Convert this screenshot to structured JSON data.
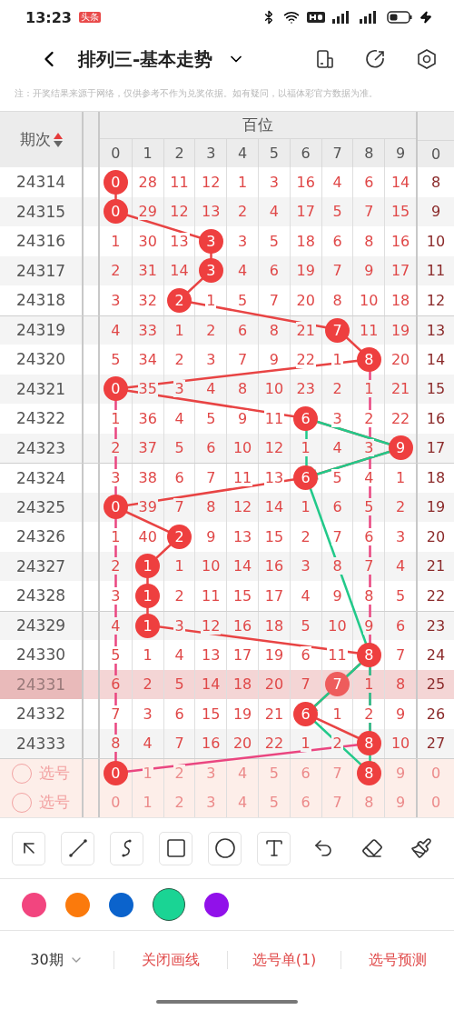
{
  "status_bar": {
    "time": "13:23",
    "badge": "头条"
  },
  "header": {
    "title": "排列三-基本走势"
  },
  "note": "注：开奖结果来源于网络，仅供参考不作为兑奖依据。如有疑问，以福体彩官方数据为准。",
  "table": {
    "period_header": "期次",
    "group_header": "百位",
    "digits": [
      "0",
      "1",
      "2",
      "3",
      "4",
      "5",
      "6",
      "7",
      "8",
      "9"
    ],
    "extra_digit": "0",
    "rows": [
      {
        "kind": "draw",
        "period": "24314",
        "highlighted": false,
        "extra": "8",
        "cells": [
          {
            "v": "0",
            "hit": true
          },
          {
            "v": "28",
            "hit": false
          },
          {
            "v": "11",
            "hit": false
          },
          {
            "v": "12",
            "hit": false
          },
          {
            "v": "1",
            "hit": false
          },
          {
            "v": "3",
            "hit": false
          },
          {
            "v": "16",
            "hit": false
          },
          {
            "v": "4",
            "hit": false
          },
          {
            "v": "6",
            "hit": false
          },
          {
            "v": "14",
            "hit": false
          }
        ]
      },
      {
        "kind": "draw",
        "period": "24315",
        "highlighted": false,
        "extra": "9",
        "cells": [
          {
            "v": "0",
            "hit": true
          },
          {
            "v": "29",
            "hit": false
          },
          {
            "v": "12",
            "hit": false
          },
          {
            "v": "13",
            "hit": false
          },
          {
            "v": "2",
            "hit": false
          },
          {
            "v": "4",
            "hit": false
          },
          {
            "v": "17",
            "hit": false
          },
          {
            "v": "5",
            "hit": false
          },
          {
            "v": "7",
            "hit": false
          },
          {
            "v": "15",
            "hit": false
          }
        ]
      },
      {
        "kind": "draw",
        "period": "24316",
        "highlighted": false,
        "extra": "10",
        "cells": [
          {
            "v": "1",
            "hit": false
          },
          {
            "v": "30",
            "hit": false
          },
          {
            "v": "13",
            "hit": false
          },
          {
            "v": "3",
            "hit": true
          },
          {
            "v": "3",
            "hit": false
          },
          {
            "v": "5",
            "hit": false
          },
          {
            "v": "18",
            "hit": false
          },
          {
            "v": "6",
            "hit": false
          },
          {
            "v": "8",
            "hit": false
          },
          {
            "v": "16",
            "hit": false
          }
        ]
      },
      {
        "kind": "draw",
        "period": "24317",
        "highlighted": false,
        "extra": "11",
        "cells": [
          {
            "v": "2",
            "hit": false
          },
          {
            "v": "31",
            "hit": false
          },
          {
            "v": "14",
            "hit": false
          },
          {
            "v": "3",
            "hit": true
          },
          {
            "v": "4",
            "hit": false
          },
          {
            "v": "6",
            "hit": false
          },
          {
            "v": "19",
            "hit": false
          },
          {
            "v": "7",
            "hit": false
          },
          {
            "v": "9",
            "hit": false
          },
          {
            "v": "17",
            "hit": false
          }
        ]
      },
      {
        "kind": "draw",
        "period": "24318",
        "highlighted": false,
        "extra": "12",
        "cells": [
          {
            "v": "3",
            "hit": false
          },
          {
            "v": "32",
            "hit": false
          },
          {
            "v": "2",
            "hit": true
          },
          {
            "v": "1",
            "hit": false
          },
          {
            "v": "5",
            "hit": false
          },
          {
            "v": "7",
            "hit": false
          },
          {
            "v": "20",
            "hit": false
          },
          {
            "v": "8",
            "hit": false
          },
          {
            "v": "10",
            "hit": false
          },
          {
            "v": "18",
            "hit": false
          }
        ]
      },
      {
        "kind": "draw",
        "period": "24319",
        "highlighted": false,
        "extra": "13",
        "cells": [
          {
            "v": "4",
            "hit": false
          },
          {
            "v": "33",
            "hit": false
          },
          {
            "v": "1",
            "hit": false
          },
          {
            "v": "2",
            "hit": false
          },
          {
            "v": "6",
            "hit": false
          },
          {
            "v": "8",
            "hit": false
          },
          {
            "v": "21",
            "hit": false
          },
          {
            "v": "7",
            "hit": true
          },
          {
            "v": "11",
            "hit": false
          },
          {
            "v": "19",
            "hit": false
          }
        ]
      },
      {
        "kind": "draw",
        "period": "24320",
        "highlighted": false,
        "extra": "14",
        "cells": [
          {
            "v": "5",
            "hit": false
          },
          {
            "v": "34",
            "hit": false
          },
          {
            "v": "2",
            "hit": false
          },
          {
            "v": "3",
            "hit": false
          },
          {
            "v": "7",
            "hit": false
          },
          {
            "v": "9",
            "hit": false
          },
          {
            "v": "22",
            "hit": false
          },
          {
            "v": "1",
            "hit": false
          },
          {
            "v": "8",
            "hit": true
          },
          {
            "v": "20",
            "hit": false
          }
        ]
      },
      {
        "kind": "draw",
        "period": "24321",
        "highlighted": false,
        "extra": "15",
        "cells": [
          {
            "v": "0",
            "hit": true
          },
          {
            "v": "35",
            "hit": false
          },
          {
            "v": "3",
            "hit": false
          },
          {
            "v": "4",
            "hit": false
          },
          {
            "v": "8",
            "hit": false
          },
          {
            "v": "10",
            "hit": false
          },
          {
            "v": "23",
            "hit": false
          },
          {
            "v": "2",
            "hit": false
          },
          {
            "v": "1",
            "hit": false
          },
          {
            "v": "21",
            "hit": false
          }
        ]
      },
      {
        "kind": "draw",
        "period": "24322",
        "highlighted": false,
        "extra": "16",
        "cells": [
          {
            "v": "1",
            "hit": false
          },
          {
            "v": "36",
            "hit": false
          },
          {
            "v": "4",
            "hit": false
          },
          {
            "v": "5",
            "hit": false
          },
          {
            "v": "9",
            "hit": false
          },
          {
            "v": "11",
            "hit": false
          },
          {
            "v": "6",
            "hit": true
          },
          {
            "v": "3",
            "hit": false
          },
          {
            "v": "2",
            "hit": false
          },
          {
            "v": "22",
            "hit": false
          }
        ]
      },
      {
        "kind": "draw",
        "period": "24323",
        "highlighted": false,
        "extra": "17",
        "cells": [
          {
            "v": "2",
            "hit": false
          },
          {
            "v": "37",
            "hit": false
          },
          {
            "v": "5",
            "hit": false
          },
          {
            "v": "6",
            "hit": false
          },
          {
            "v": "10",
            "hit": false
          },
          {
            "v": "12",
            "hit": false
          },
          {
            "v": "1",
            "hit": false
          },
          {
            "v": "4",
            "hit": false
          },
          {
            "v": "3",
            "hit": false
          },
          {
            "v": "9",
            "hit": true
          }
        ]
      },
      {
        "kind": "draw",
        "period": "24324",
        "highlighted": false,
        "extra": "18",
        "cells": [
          {
            "v": "3",
            "hit": false
          },
          {
            "v": "38",
            "hit": false
          },
          {
            "v": "6",
            "hit": false
          },
          {
            "v": "7",
            "hit": false
          },
          {
            "v": "11",
            "hit": false
          },
          {
            "v": "13",
            "hit": false
          },
          {
            "v": "6",
            "hit": true
          },
          {
            "v": "5",
            "hit": false
          },
          {
            "v": "4",
            "hit": false
          },
          {
            "v": "1",
            "hit": false
          }
        ]
      },
      {
        "kind": "draw",
        "period": "24325",
        "highlighted": false,
        "extra": "19",
        "cells": [
          {
            "v": "0",
            "hit": true
          },
          {
            "v": "39",
            "hit": false
          },
          {
            "v": "7",
            "hit": false
          },
          {
            "v": "8",
            "hit": false
          },
          {
            "v": "12",
            "hit": false
          },
          {
            "v": "14",
            "hit": false
          },
          {
            "v": "1",
            "hit": false
          },
          {
            "v": "6",
            "hit": false
          },
          {
            "v": "5",
            "hit": false
          },
          {
            "v": "2",
            "hit": false
          }
        ]
      },
      {
        "kind": "draw",
        "period": "24326",
        "highlighted": false,
        "extra": "20",
        "cells": [
          {
            "v": "1",
            "hit": false
          },
          {
            "v": "40",
            "hit": false
          },
          {
            "v": "2",
            "hit": true
          },
          {
            "v": "9",
            "hit": false
          },
          {
            "v": "13",
            "hit": false
          },
          {
            "v": "15",
            "hit": false
          },
          {
            "v": "2",
            "hit": false
          },
          {
            "v": "7",
            "hit": false
          },
          {
            "v": "6",
            "hit": false
          },
          {
            "v": "3",
            "hit": false
          }
        ]
      },
      {
        "kind": "draw",
        "period": "24327",
        "highlighted": false,
        "extra": "21",
        "cells": [
          {
            "v": "2",
            "hit": false
          },
          {
            "v": "1",
            "hit": true
          },
          {
            "v": "1",
            "hit": false
          },
          {
            "v": "10",
            "hit": false
          },
          {
            "v": "14",
            "hit": false
          },
          {
            "v": "16",
            "hit": false
          },
          {
            "v": "3",
            "hit": false
          },
          {
            "v": "8",
            "hit": false
          },
          {
            "v": "7",
            "hit": false
          },
          {
            "v": "4",
            "hit": false
          }
        ]
      },
      {
        "kind": "draw",
        "period": "24328",
        "highlighted": false,
        "extra": "22",
        "cells": [
          {
            "v": "3",
            "hit": false
          },
          {
            "v": "1",
            "hit": true
          },
          {
            "v": "2",
            "hit": false
          },
          {
            "v": "11",
            "hit": false
          },
          {
            "v": "15",
            "hit": false
          },
          {
            "v": "17",
            "hit": false
          },
          {
            "v": "4",
            "hit": false
          },
          {
            "v": "9",
            "hit": false
          },
          {
            "v": "8",
            "hit": false
          },
          {
            "v": "5",
            "hit": false
          }
        ]
      },
      {
        "kind": "draw",
        "period": "24329",
        "highlighted": false,
        "extra": "23",
        "cells": [
          {
            "v": "4",
            "hit": false
          },
          {
            "v": "1",
            "hit": true
          },
          {
            "v": "3",
            "hit": false
          },
          {
            "v": "12",
            "hit": false
          },
          {
            "v": "16",
            "hit": false
          },
          {
            "v": "18",
            "hit": false
          },
          {
            "v": "5",
            "hit": false
          },
          {
            "v": "10",
            "hit": false
          },
          {
            "v": "9",
            "hit": false
          },
          {
            "v": "6",
            "hit": false
          }
        ]
      },
      {
        "kind": "draw",
        "period": "24330",
        "highlighted": false,
        "extra": "24",
        "cells": [
          {
            "v": "5",
            "hit": false
          },
          {
            "v": "1",
            "hit": false
          },
          {
            "v": "4",
            "hit": false
          },
          {
            "v": "13",
            "hit": false
          },
          {
            "v": "17",
            "hit": false
          },
          {
            "v": "19",
            "hit": false
          },
          {
            "v": "6",
            "hit": false
          },
          {
            "v": "11",
            "hit": false
          },
          {
            "v": "8",
            "hit": true
          },
          {
            "v": "7",
            "hit": false
          }
        ]
      },
      {
        "kind": "draw",
        "period": "24331",
        "highlighted": true,
        "extra": "25",
        "cells": [
          {
            "v": "6",
            "hit": false
          },
          {
            "v": "2",
            "hit": false
          },
          {
            "v": "5",
            "hit": false
          },
          {
            "v": "14",
            "hit": false
          },
          {
            "v": "18",
            "hit": false
          },
          {
            "v": "20",
            "hit": false
          },
          {
            "v": "7",
            "hit": false
          },
          {
            "v": "7",
            "hit": true
          },
          {
            "v": "1",
            "hit": false
          },
          {
            "v": "8",
            "hit": false
          }
        ]
      },
      {
        "kind": "draw",
        "period": "24332",
        "highlighted": false,
        "extra": "26",
        "cells": [
          {
            "v": "7",
            "hit": false
          },
          {
            "v": "3",
            "hit": false
          },
          {
            "v": "6",
            "hit": false
          },
          {
            "v": "15",
            "hit": false
          },
          {
            "v": "19",
            "hit": false
          },
          {
            "v": "21",
            "hit": false
          },
          {
            "v": "6",
            "hit": true
          },
          {
            "v": "1",
            "hit": false
          },
          {
            "v": "2",
            "hit": false
          },
          {
            "v": "9",
            "hit": false
          }
        ]
      },
      {
        "kind": "draw",
        "period": "24333",
        "highlighted": false,
        "extra": "27",
        "cells": [
          {
            "v": "8",
            "hit": false
          },
          {
            "v": "4",
            "hit": false
          },
          {
            "v": "7",
            "hit": false
          },
          {
            "v": "16",
            "hit": false
          },
          {
            "v": "20",
            "hit": false
          },
          {
            "v": "22",
            "hit": false
          },
          {
            "v": "1",
            "hit": false
          },
          {
            "v": "2",
            "hit": false
          },
          {
            "v": "8",
            "hit": true
          },
          {
            "v": "10",
            "hit": false
          }
        ]
      },
      {
        "kind": "pick",
        "period": "选号",
        "checked": false,
        "extra": "0",
        "cells": [
          {
            "v": "0",
            "hit": true
          },
          {
            "v": "1",
            "hit": false
          },
          {
            "v": "2",
            "hit": false
          },
          {
            "v": "3",
            "hit": false
          },
          {
            "v": "4",
            "hit": false
          },
          {
            "v": "5",
            "hit": false
          },
          {
            "v": "6",
            "hit": false
          },
          {
            "v": "7",
            "hit": false
          },
          {
            "v": "8",
            "hit": true
          },
          {
            "v": "9",
            "hit": false
          }
        ]
      },
      {
        "kind": "pick",
        "period": "选号",
        "checked": false,
        "extra": "0",
        "cells": [
          {
            "v": "0",
            "hit": false
          },
          {
            "v": "1",
            "hit": false
          },
          {
            "v": "2",
            "hit": false
          },
          {
            "v": "3",
            "hit": false
          },
          {
            "v": "4",
            "hit": false
          },
          {
            "v": "5",
            "hit": false
          },
          {
            "v": "6",
            "hit": false
          },
          {
            "v": "7",
            "hit": false
          },
          {
            "v": "8",
            "hit": false
          },
          {
            "v": "9",
            "hit": false
          }
        ]
      }
    ]
  },
  "palette": [
    {
      "color": "#f2457f",
      "selected": false
    },
    {
      "color": "#fb7a0c",
      "selected": false
    },
    {
      "color": "#0b63cc",
      "selected": false
    },
    {
      "color": "#1ad494",
      "selected": true
    },
    {
      "color": "#9111ea",
      "selected": false
    }
  ],
  "bottom_bar": {
    "period_picker": "30期",
    "actions": [
      "关闭画线",
      "选号单(1)",
      "选号预测"
    ]
  }
}
